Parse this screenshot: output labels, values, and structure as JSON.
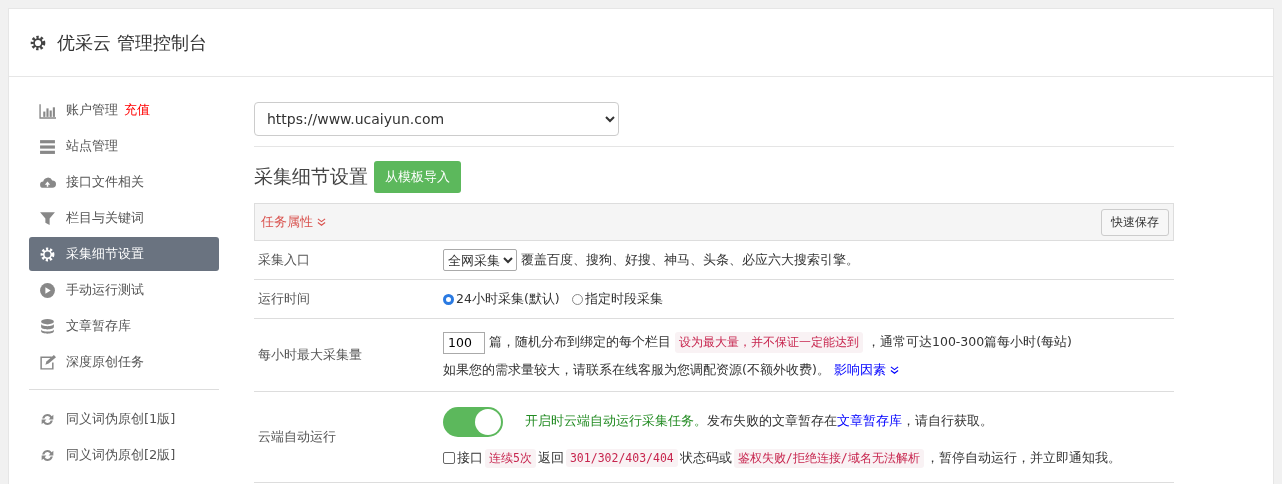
{
  "header": {
    "title": "优采云 管理控制台"
  },
  "sidebar": {
    "groups": [
      [
        {
          "label": "账户管理",
          "badge": "充值",
          "selected": false
        },
        {
          "label": "站点管理",
          "selected": false
        },
        {
          "label": "接口文件相关",
          "selected": false
        },
        {
          "label": "栏目与关键词",
          "selected": false
        },
        {
          "label": "采集细节设置",
          "selected": true
        },
        {
          "label": "手动运行测试",
          "selected": false
        },
        {
          "label": "文章暂存库",
          "selected": false
        },
        {
          "label": "深度原创任务",
          "selected": false
        }
      ],
      [
        {
          "label": "同义词伪原创[1版]",
          "selected": false
        },
        {
          "label": "同义词伪原创[2版]",
          "selected": false
        }
      ]
    ]
  },
  "site_select": {
    "value": "https://www.ucaiyun.com"
  },
  "section": {
    "title": "采集细节设置",
    "import_button": "从模板导入"
  },
  "panel": {
    "title": "任务属性",
    "save_button": "快速保存"
  },
  "rows": [
    {
      "kind": "select",
      "label": "采集入口",
      "select": "全网采集",
      "text": "覆盖百度、搜狗、好搜、神马、头条、必应六大搜索引擎。"
    },
    {
      "kind": "radio",
      "label": "运行时间",
      "options": [
        {
          "label": "24小时采集(默认)",
          "selected": true
        },
        {
          "label": "指定时段采集",
          "selected": false
        }
      ]
    },
    {
      "kind": "amount",
      "label": "每小时最大采集量",
      "value": "100",
      "unit": "篇，随机分布到绑定的每个栏目",
      "tag": "设为最大量，并不保证一定能达到",
      "after": "，通常可达100-300篇每小时(每站)",
      "note": "如果您的需求量较大，请联系在线客服为您调配资源(不额外收费)。",
      "link": "影响因素"
    },
    {
      "kind": "toggle",
      "label": "云端自动运行",
      "on": true,
      "green_text": "开启时云端自动运行采集任务。",
      "text": "发布失败的文章暂存在",
      "link": "文章暂存库",
      "after": "，请自行获取。",
      "checkbox": {
        "checked": false,
        "parts": [
          {
            "text": "接口",
            "code": false
          },
          {
            "text": "连续5次",
            "code": true
          },
          {
            "text": "返回",
            "code": false
          },
          {
            "text": "301/302/403/404",
            "code": true
          },
          {
            "text": "状态码或",
            "code": false
          },
          {
            "text": "鉴权失败/拒绝连接/域名无法解析",
            "code": true
          },
          {
            "text": "，暂停自动运行，并立即通知我。",
            "code": false
          }
        ]
      }
    }
  ]
}
